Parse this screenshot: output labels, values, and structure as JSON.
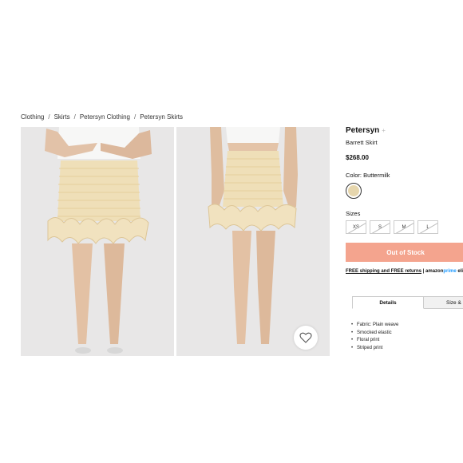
{
  "breadcrumb": {
    "items": [
      "Clothing",
      "Skirts",
      "Petersyn Clothing",
      "Petersyn Skirts"
    ],
    "separator": "/"
  },
  "product": {
    "brand": "Petersyn",
    "brand_follow_icon": "plus-icon",
    "name": "Barrett Skirt",
    "price": "$268.00",
    "color_label": "Color: Buttermilk",
    "swatch_color": "#e6d6ad",
    "sizes_label": "Sizes",
    "sizes": [
      "XS",
      "S",
      "M",
      "L"
    ],
    "out_of_stock_label": "Out of Stock",
    "out_of_stock_color": "#f4a48e"
  },
  "shipping": {
    "free_shipping": "FREE shipping and FREE returns",
    "divider": "|",
    "amazon": "amazon",
    "prime": "prime",
    "eligible": "eli"
  },
  "tabs": {
    "details": "Details",
    "size": "Size &"
  },
  "details_list": [
    "Fabric: Plain weave",
    "Smocked elastic",
    "Floral print",
    "Striped print"
  ],
  "icons": {
    "favorite": "heart-icon"
  }
}
